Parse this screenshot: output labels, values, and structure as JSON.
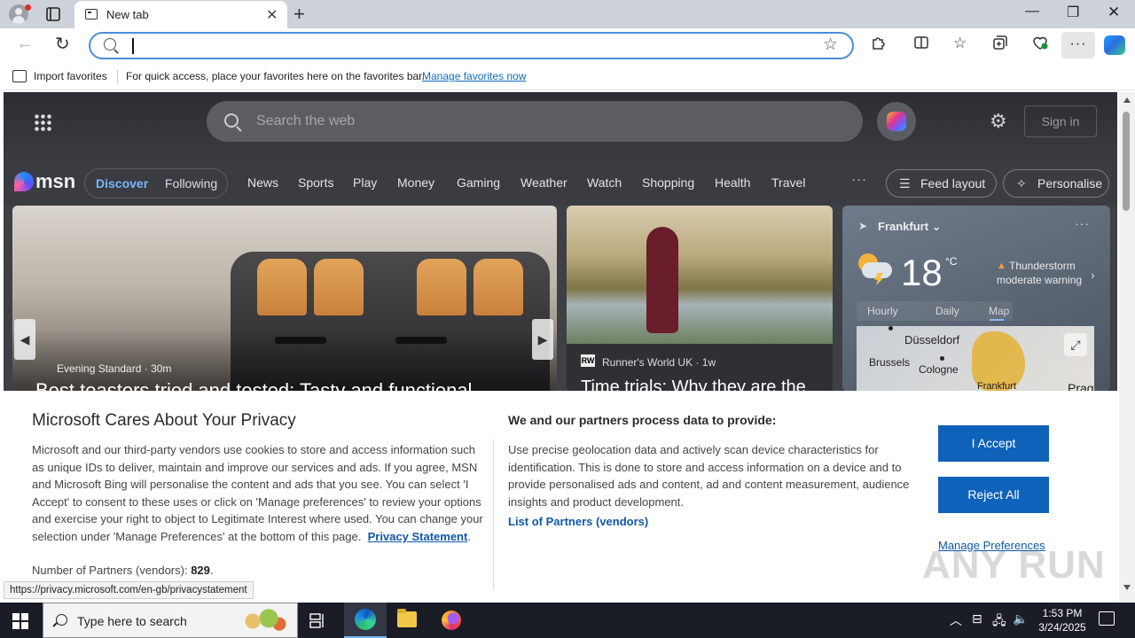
{
  "browser": {
    "tab_title": "New tab",
    "address_value": "",
    "favorites_bar": {
      "import_label": "Import favorites",
      "hint": "For quick access, place your favorites here on the favorites bar.",
      "manage_link": "Manage favorites now"
    },
    "status_url": "https://privacy.microsoft.com/en-gb/privacystatement"
  },
  "msn": {
    "search_placeholder": "Search the web",
    "sign_in": "Sign in",
    "logo_text": "msn",
    "nav": {
      "discover": "Discover",
      "following": "Following",
      "items": [
        "News",
        "Sports",
        "Play",
        "Money",
        "Gaming",
        "Weather",
        "Watch",
        "Shopping",
        "Health",
        "Travel"
      ],
      "more": "···",
      "feed_layout": "Feed layout",
      "personalise": "Personalise"
    },
    "hero": {
      "source": "Evening Standard · 30m",
      "title": "Best toasters tried and tested: Tasty and functional"
    },
    "card2": {
      "source_badge": "RW",
      "source": "Runner's World UK · 1w",
      "title": "Time trials: Why they are the"
    },
    "weather": {
      "location": "Frankfurt",
      "temperature": "18",
      "unit": "°C",
      "alert_line1": "Thunderstorm",
      "alert_line2": "moderate warning",
      "tabs": [
        "Hourly",
        "Daily",
        "Map"
      ],
      "map_labels": [
        "Düsseldorf",
        "Brussels",
        "Cologne",
        "Frankfurt",
        "Prag"
      ]
    }
  },
  "privacy": {
    "title": "Microsoft Cares About Your Privacy",
    "body": "Microsoft and our third-party vendors use cookies to store and access information such as unique IDs to deliver, maintain and improve our services and ads. If you agree, MSN and Microsoft Bing will personalise the content and ads that you see. You can select 'I Accept' to consent to these uses or click on 'Manage preferences' to review your options and exercise your right to object to Legitimate Interest where used.  You can change your selection under 'Manage Preferences' at the bottom of this page.",
    "privacy_link": "Privacy Statement",
    "partners_prefix": "Number of Partners (vendors):",
    "partners_count": "829",
    "process_title": "We and our partners process data to provide:",
    "process_body": "Use precise geolocation data and actively scan device characteristics for identification. This is done to store and access information on a device and to provide personalised ads and content, ad and content measurement, audience insights and product development.",
    "partners_link": "List of Partners (vendors)",
    "accept": "I Accept",
    "reject": "Reject All",
    "manage": "Manage Preferences",
    "watermark": "ANY RUN"
  },
  "taskbar": {
    "search_label": "Type here to search",
    "time": "1:53 PM",
    "date": "3/24/2025"
  }
}
